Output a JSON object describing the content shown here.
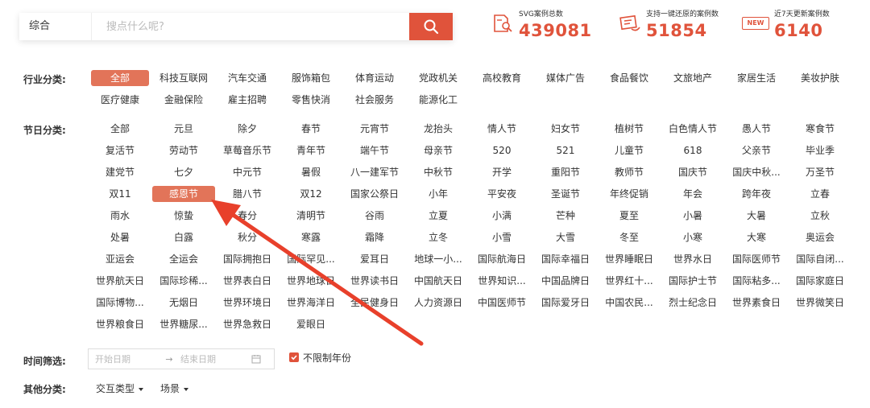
{
  "search": {
    "scope": "综合",
    "placeholder": "搜点什么呢?"
  },
  "stats": [
    {
      "label": "SVG案例总数",
      "value": "439081",
      "icon": "document-search-icon"
    },
    {
      "label": "支持一键还原的案例数",
      "value": "51854",
      "icon": "restore-icon"
    },
    {
      "label": "近7天更新案例数",
      "value": "6140",
      "icon": "new-badge-icon",
      "badge": "NEW"
    }
  ],
  "industry": {
    "label": "行业分类:",
    "items": [
      "全部",
      "科技互联网",
      "汽车交通",
      "服饰箱包",
      "体育运动",
      "党政机关",
      "高校教育",
      "媒体广告",
      "食品餐饮",
      "文旅地产",
      "家居生活",
      "美妆护肤",
      "医疗健康",
      "金融保险",
      "雇主招聘",
      "零售快消",
      "社会服务",
      "能源化工"
    ],
    "active": 0
  },
  "festival": {
    "label": "节日分类:",
    "items": [
      "全部",
      "元旦",
      "除夕",
      "春节",
      "元宵节",
      "龙抬头",
      "情人节",
      "妇女节",
      "植树节",
      "白色情人节",
      "愚人节",
      "寒食节",
      "复活节",
      "劳动节",
      "草莓音乐节",
      "青年节",
      "端午节",
      "母亲节",
      "520",
      "521",
      "儿童节",
      "618",
      "父亲节",
      "毕业季",
      "建党节",
      "七夕",
      "中元节",
      "暑假",
      "八一建军节",
      "中秋节",
      "开学",
      "重阳节",
      "教师节",
      "国庆节",
      "国庆中秋...",
      "万圣节",
      "双11",
      "感恩节",
      "腊八节",
      "双12",
      "国家公祭日",
      "小年",
      "平安夜",
      "圣诞节",
      "年终促销",
      "年会",
      "跨年夜",
      "立春",
      "雨水",
      "惊蛰",
      "春分",
      "清明节",
      "谷雨",
      "立夏",
      "小满",
      "芒种",
      "夏至",
      "小暑",
      "大暑",
      "立秋",
      "处暑",
      "白露",
      "秋分",
      "寒露",
      "霜降",
      "立冬",
      "小雪",
      "大雪",
      "冬至",
      "小寒",
      "大寒",
      "奥运会",
      "亚运会",
      "全运会",
      "国际拥抱日",
      "国际罕见...",
      "爱耳日",
      "地球一小...",
      "国际航海日",
      "国际幸福日",
      "世界睡眠日",
      "世界水日",
      "国际医师节",
      "国际自闭...",
      "世界航天日",
      "国际珍稀...",
      "世界表白日",
      "世界地球日",
      "世界读书日",
      "中国航天日",
      "世界知识...",
      "中国品牌日",
      "世界红十...",
      "国际护士节",
      "国际粘多...",
      "国际家庭日",
      "国际博物...",
      "无烟日",
      "世界环境日",
      "世界海洋日",
      "全民健身日",
      "人力资源日",
      "中国医师节",
      "国际爱牙日",
      "中国农民...",
      "烈士纪念日",
      "世界素食日",
      "世界微笑日",
      "世界粮食日",
      "世界糖尿...",
      "世界急救日",
      "爱眼日"
    ],
    "active": 37
  },
  "time_filter": {
    "label": "时间筛选:",
    "start_placeholder": "开始日期",
    "arrow": "→",
    "end_placeholder": "结束日期",
    "unlimited_label": "不限制年份",
    "unlimited_checked": true
  },
  "other": {
    "label": "其他分类:",
    "dropdowns": [
      "交互类型",
      "场景"
    ]
  },
  "colors": {
    "accent": "#e0533b",
    "active_tag": "#e27459",
    "arrow": "#e8402b"
  }
}
